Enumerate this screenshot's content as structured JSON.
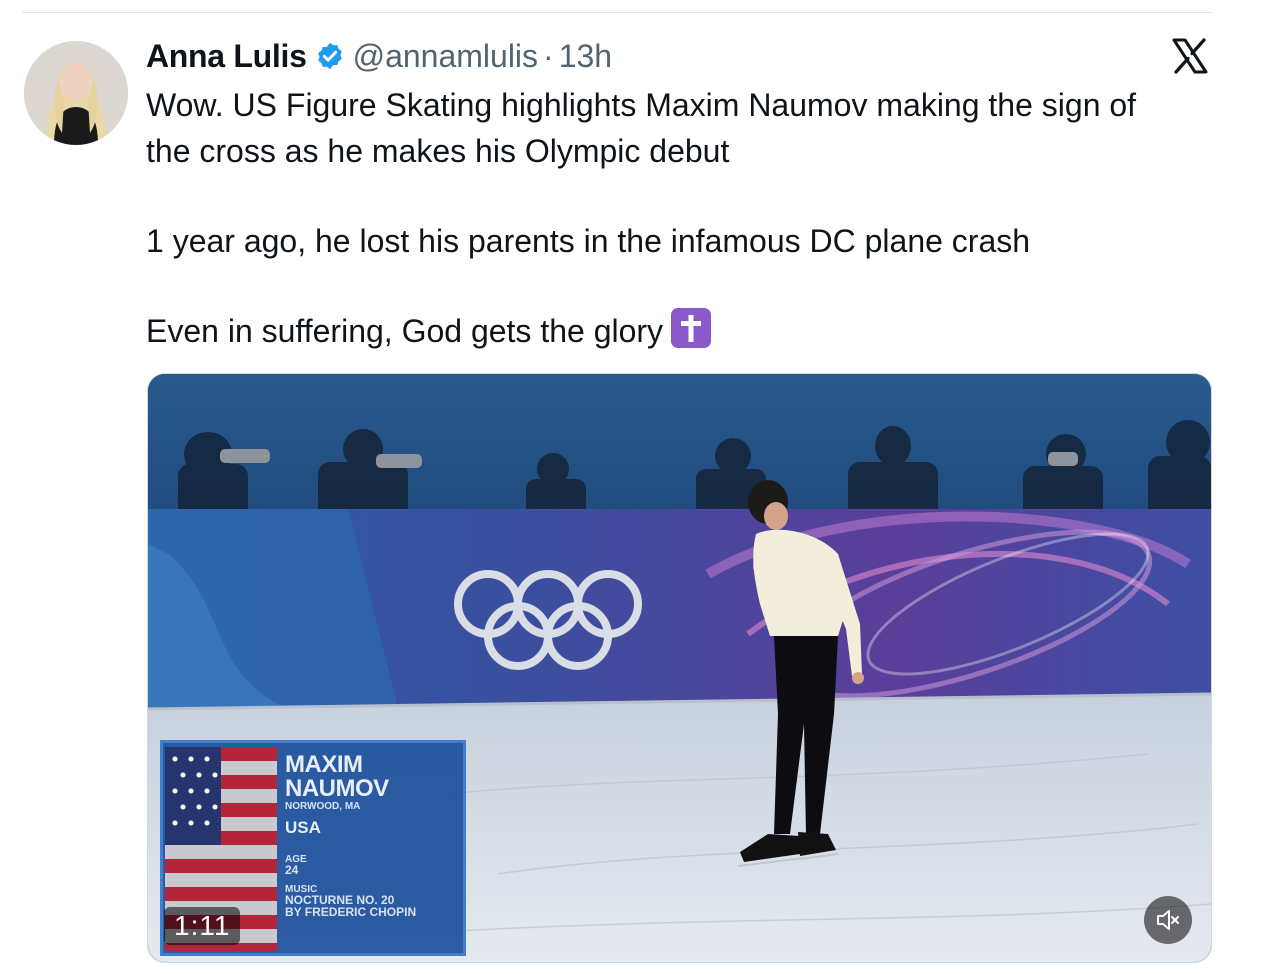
{
  "author": {
    "display_name": "Anna Lulis",
    "handle": "@annamlulis",
    "separator": "·",
    "time": "13h",
    "verified_badge_icon": "verified-badge-icon",
    "avatar": "avatar"
  },
  "platform_icon": "x-logo-icon",
  "tweet": {
    "line1": "Wow. US Figure Skating highlights Maxim Naumov making the sign of",
    "line2": "the cross as he makes his Olympic debut",
    "line3": "1 year ago, he lost his parents in the infamous DC plane crash",
    "line4": "Even in suffering, God gets the glory",
    "emoji": "latin-cross-emoji"
  },
  "video": {
    "duration": "1:11",
    "mute_icon": "speaker-muted-icon",
    "lower_third": {
      "first_name": "MAXIM",
      "last_name": "NAUMOV",
      "hometown": "NORWOOD, MA",
      "country": "USA",
      "age_label": "AGE",
      "age": "24",
      "music_label": "MUSIC",
      "music_title": "NOCTURNE NO. 20",
      "music_composer": "BY FREDERIC CHOPIN"
    }
  },
  "colors": {
    "text": "#0f1419",
    "muted": "#536471",
    "verified": "#1d9bf0",
    "emoji_bg": "#8a58c8"
  }
}
